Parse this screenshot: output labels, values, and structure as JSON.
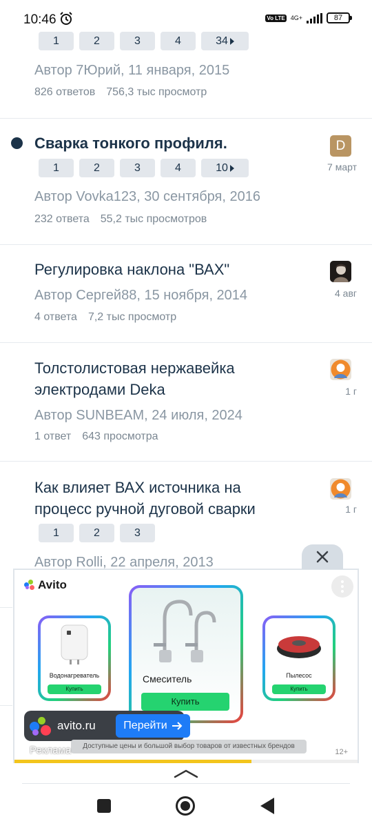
{
  "status_bar": {
    "time": "10:46",
    "volte": "Vo LTE",
    "network": "4G+",
    "battery": "87"
  },
  "topics": [
    {
      "title": "",
      "pages": [
        "1",
        "2",
        "3",
        "4",
        "34"
      ],
      "author_line": "Автор 7Юрий, 11 января, 2015",
      "replies": "826 ответов",
      "views": "756,3 тыс просмотр",
      "date": "",
      "unread": false
    },
    {
      "title": "Сварка тонкого профиля.",
      "pages": [
        "1",
        "2",
        "3",
        "4",
        "10"
      ],
      "author_line": "Автор Vovka123, 30 сентября, 2016",
      "replies": "232 ответа",
      "views": "55,2 тыс просмотров",
      "avatar_letter": "D",
      "date": "7 март",
      "unread": true
    },
    {
      "title": "Регулировка наклона \"ВАХ\"",
      "pages": [],
      "author_line": "Автор Сергей88, 15 ноября, 2014",
      "replies": "4 ответа",
      "views": "7,2 тыс просмотр",
      "date": "4 авг",
      "unread": false
    },
    {
      "title": "Толстолистовая нержавейка электродами Deka",
      "pages": [],
      "author_line": "Автор SUNBEAM, 24 июля, 2024",
      "replies": "1 ответ",
      "views": "643 просмотра",
      "date": "1 г",
      "unread": false
    },
    {
      "title": "Как влияет ВАХ источника на процесс ручной дуговой сварки",
      "pages": [
        "1",
        "2",
        "3"
      ],
      "author_line": "Автор Rolli, 22 апреля, 2013",
      "replies": "",
      "views": "",
      "date": "1 г",
      "unread": false
    }
  ],
  "ad": {
    "brand": "Avito",
    "products": [
      {
        "label": "Водонагреватель",
        "button": "Купить"
      },
      {
        "label": "Смеситель",
        "button": "Купить"
      },
      {
        "label": "Пылесос",
        "button": "Купить"
      }
    ],
    "domain": "avito.ru",
    "cta": "Перейти",
    "disclaimer": "Доступные цены и большой выбор товаров от известных брендов",
    "label": "Реклама",
    "age": "12+",
    "progress": 0.69
  },
  "icons": {
    "alarm": "alarm-clock-icon",
    "close": "close-icon",
    "more": "more-vertical-icon",
    "arrow": "arrow-right-icon",
    "recents": "recents-square-icon",
    "home": "home-circle-icon",
    "back": "back-triangle-icon",
    "handle": "chevron-up-icon"
  }
}
